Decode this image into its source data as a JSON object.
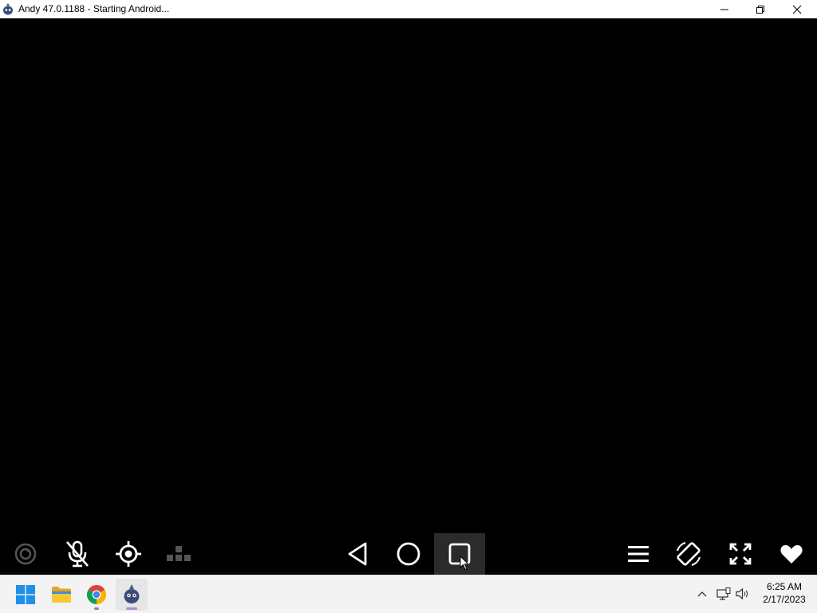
{
  "window": {
    "title": "Andy 47.0.1188 - Starting Android...",
    "controls": {
      "minimize_icon": "minimize-icon",
      "maximize_icon": "restore-icon",
      "close_icon": "close-icon"
    }
  },
  "emulator_toolbar": {
    "left_tools": [
      "screenshot-icon",
      "mic-muted-icon",
      "gps-icon",
      "keymap-icon"
    ],
    "nav": [
      "back-icon",
      "home-icon",
      "recents-icon"
    ],
    "active_item": "recents",
    "right_tools": [
      "menu-icon",
      "rotate-icon",
      "fullscreen-icon",
      "heart-icon"
    ]
  },
  "taskbar": {
    "apps": [
      "windows-start-icon",
      "file-explorer-icon",
      "chrome-icon",
      "andy-icon"
    ],
    "tray": [
      "chevron-up-icon",
      "network-icon",
      "volume-icon"
    ],
    "clock": {
      "time": "6:25 AM",
      "date": "2/17/2023"
    }
  },
  "colors": {
    "screen": "#000000",
    "taskbar": "#f3f3f3",
    "active_indicator": "#b08bd6",
    "toolbar_icon": "#ffffff",
    "toolbar_icon_disabled": "#555555"
  }
}
